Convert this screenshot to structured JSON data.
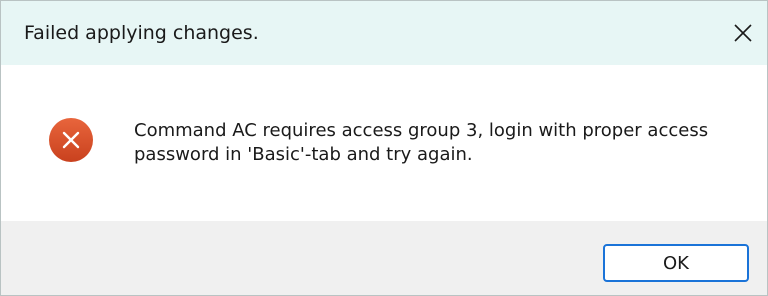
{
  "dialog": {
    "title": "Failed applying changes.",
    "close_icon": "close-icon",
    "error_icon": "error-x-icon",
    "message": "Command AC requires access group 3, login with proper access password in 'Basic'-tab and try again.",
    "ok_label": "OK"
  },
  "colors": {
    "titlebar_bg": "#e7f6f5",
    "footer_bg": "#f0f0f0",
    "error_icon": "#d9522c",
    "button_border": "#1a73d8"
  }
}
